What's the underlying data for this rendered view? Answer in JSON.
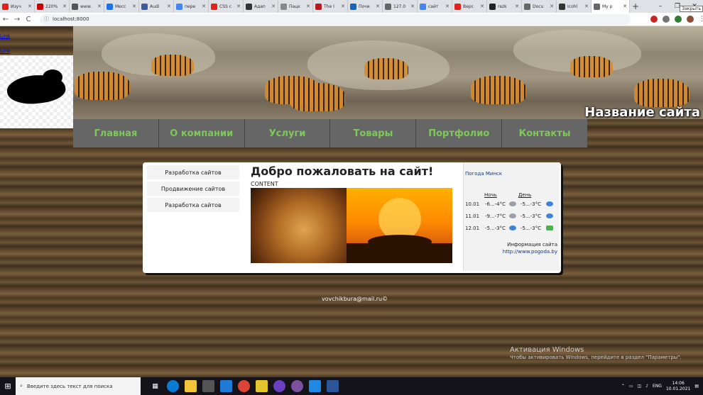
{
  "browser": {
    "tabs": [
      {
        "title": "Изуч",
        "color": "#e62117"
      },
      {
        "title": "220%",
        "color": "#c80000"
      },
      {
        "title": "www.",
        "color": "#555555"
      },
      {
        "title": "Месс",
        "color": "#1a73e8"
      },
      {
        "title": "Audi",
        "color": "#3a5ba0"
      },
      {
        "title": "пере",
        "color": "#4285f4"
      },
      {
        "title": "CSS с",
        "color": "#e62117"
      },
      {
        "title": "Адап",
        "color": "#333333"
      },
      {
        "title": "Пацк",
        "color": "#888888"
      },
      {
        "title": "The I",
        "color": "#b71c1c"
      },
      {
        "title": "Почи",
        "color": "#1565c0"
      },
      {
        "title": "127.0",
        "color": "#666666"
      },
      {
        "title": "сайт",
        "color": "#4285f4"
      },
      {
        "title": "Верс",
        "color": "#e62117"
      },
      {
        "title": "rezk",
        "color": "#222222"
      },
      {
        "title": "Docu",
        "color": "#666666"
      },
      {
        "title": "Icohl",
        "color": "#333333"
      },
      {
        "title": "My p",
        "color": "#666666",
        "active": true
      }
    ],
    "new_tab": "+",
    "close_tooltip": "Закрыть",
    "url": "localhost:8000",
    "back": "←",
    "forward": "→",
    "reload": "C"
  },
  "site": {
    "top_links": [
      "Link",
      "Link"
    ],
    "site_name": "Название сайта",
    "nav": [
      "Главная",
      "О компании",
      "Услуги",
      "Товары",
      "Портфолио",
      "Контакты"
    ],
    "left_menu": [
      "Разработка сайтов",
      "Продвижение сайтов",
      "Разработка сайтов"
    ],
    "welcome": "Добро пожаловать на сайт!",
    "content_label": "CONTENT",
    "footer_email": "vovchikbura@mail.ru©"
  },
  "weather": {
    "title": "Погода Минск",
    "col_night": "Ночь",
    "col_day": "День",
    "rows": [
      {
        "date": "10.01",
        "night": "-6...-4°C",
        "day": "-5...-3°C"
      },
      {
        "date": "11.01",
        "night": "-9...-7°C",
        "day": "-5...-3°C"
      },
      {
        "date": "12.01",
        "night": "-5...-3°C",
        "day": "-5...-3°C"
      }
    ],
    "info": "Информация сайта",
    "link": "http://www.pogoda.by"
  },
  "windows": {
    "activation_title": "Активация Windows",
    "activation_text": "Чтобы активировать Windows, перейдите в раздел \"Параметры\".",
    "search_placeholder": "Введите здесь текст для поиска",
    "lang": "ENG",
    "time": "14:06",
    "date": "10.01.2021"
  }
}
